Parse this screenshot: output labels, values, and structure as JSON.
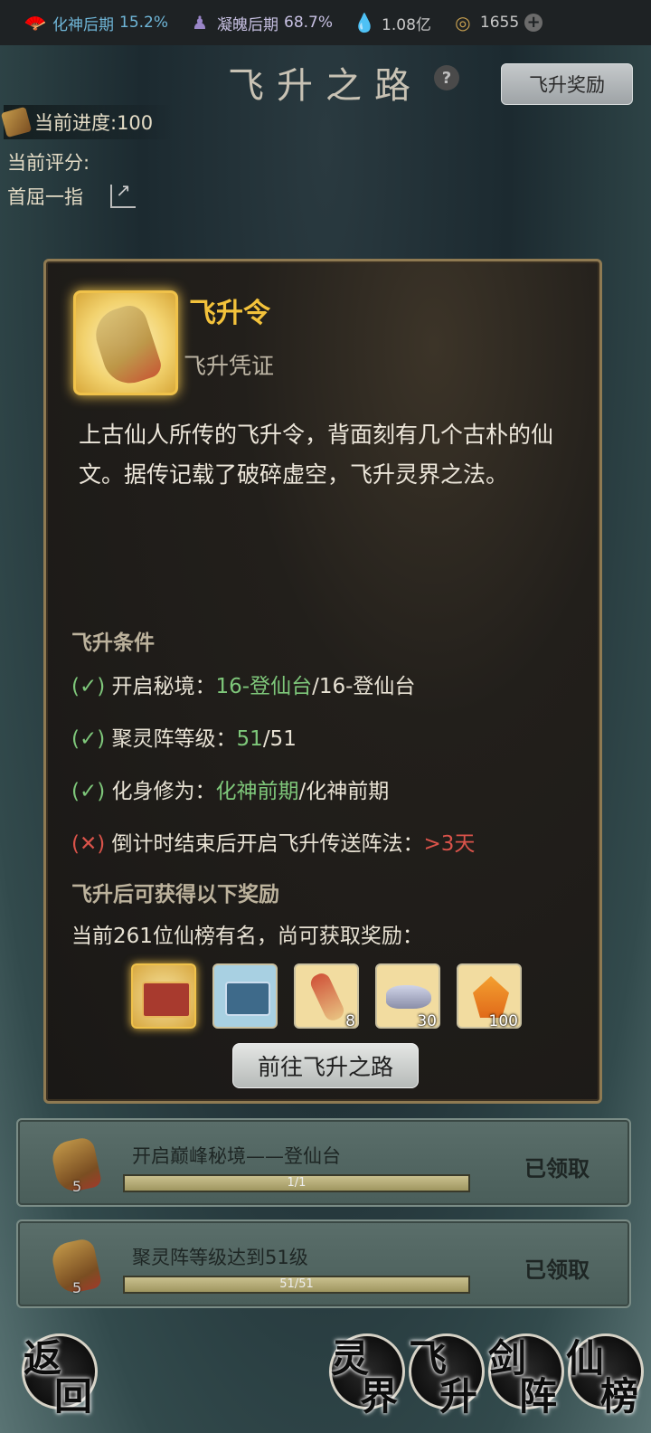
{
  "topbar": {
    "realm1": {
      "name": "化神后期",
      "value": "15.2%"
    },
    "realm2": {
      "name": "凝魄后期",
      "value": "68.7%"
    },
    "spirit": {
      "value": "1.08亿"
    },
    "coins": {
      "value": "1655"
    }
  },
  "header": {
    "title": "飞升之路",
    "help_label": "?",
    "reward_button": "飞升奖励"
  },
  "left_info": {
    "progress": "当前进度:100",
    "score_label": "当前评分:",
    "rank": "首屈一指"
  },
  "card": {
    "item_name": "飞升令",
    "item_type": "飞升凭证",
    "description": "上古仙人所传的飞升令，背面刻有几个古朴的仙文。据传记载了破碎虚空，飞升灵界之法。",
    "conditions_title": "飞升条件",
    "conditions": [
      {
        "mark": "(✓)",
        "label": "开启秘境：",
        "current": "16-登仙台",
        "target": "/16-登仙台",
        "ok": true
      },
      {
        "mark": "(✓)",
        "label": "聚灵阵等级：",
        "current": "51",
        "target": "/51",
        "ok": true
      },
      {
        "mark": "(✓)",
        "label": "化身修为：",
        "current": "化神前期",
        "target": "/化神前期",
        "ok": true
      },
      {
        "mark": "(✕)",
        "label": "倒计时结束后开启飞升传送阵法：",
        "current": ">3天",
        "target": "",
        "ok": false
      }
    ],
    "rewards_title": "飞升后可获得以下奖励",
    "rewards_sub": "当前261位仙榜有名，尚可获取奖励：",
    "rewards": [
      {
        "icon": "treasure-chest-icon",
        "count": ""
      },
      {
        "icon": "blue-chest-icon",
        "count": ""
      },
      {
        "icon": "scroll-token-icon",
        "count": "8"
      },
      {
        "icon": "spirit-stone-icon",
        "count": "30"
      },
      {
        "icon": "fire-crystal-icon",
        "count": "100"
      }
    ],
    "go_button": "前往飞升之路"
  },
  "tasks": [
    {
      "label": "开启巅峰秘境——登仙台",
      "count": "5",
      "progress_text": "1/1",
      "progress": 1.0,
      "status": "已领取"
    },
    {
      "label": "聚灵阵等级达到51级",
      "count": "5",
      "progress_text": "51/51",
      "progress": 1.0,
      "status": "已领取"
    }
  ],
  "nav": {
    "back": [
      "返",
      "回"
    ],
    "spirit_realm": [
      "灵",
      "界"
    ],
    "ascend": [
      "飞",
      "升"
    ],
    "sword_array": [
      "剑",
      "阵"
    ],
    "immortal_rank": [
      "仙",
      "榜"
    ]
  }
}
